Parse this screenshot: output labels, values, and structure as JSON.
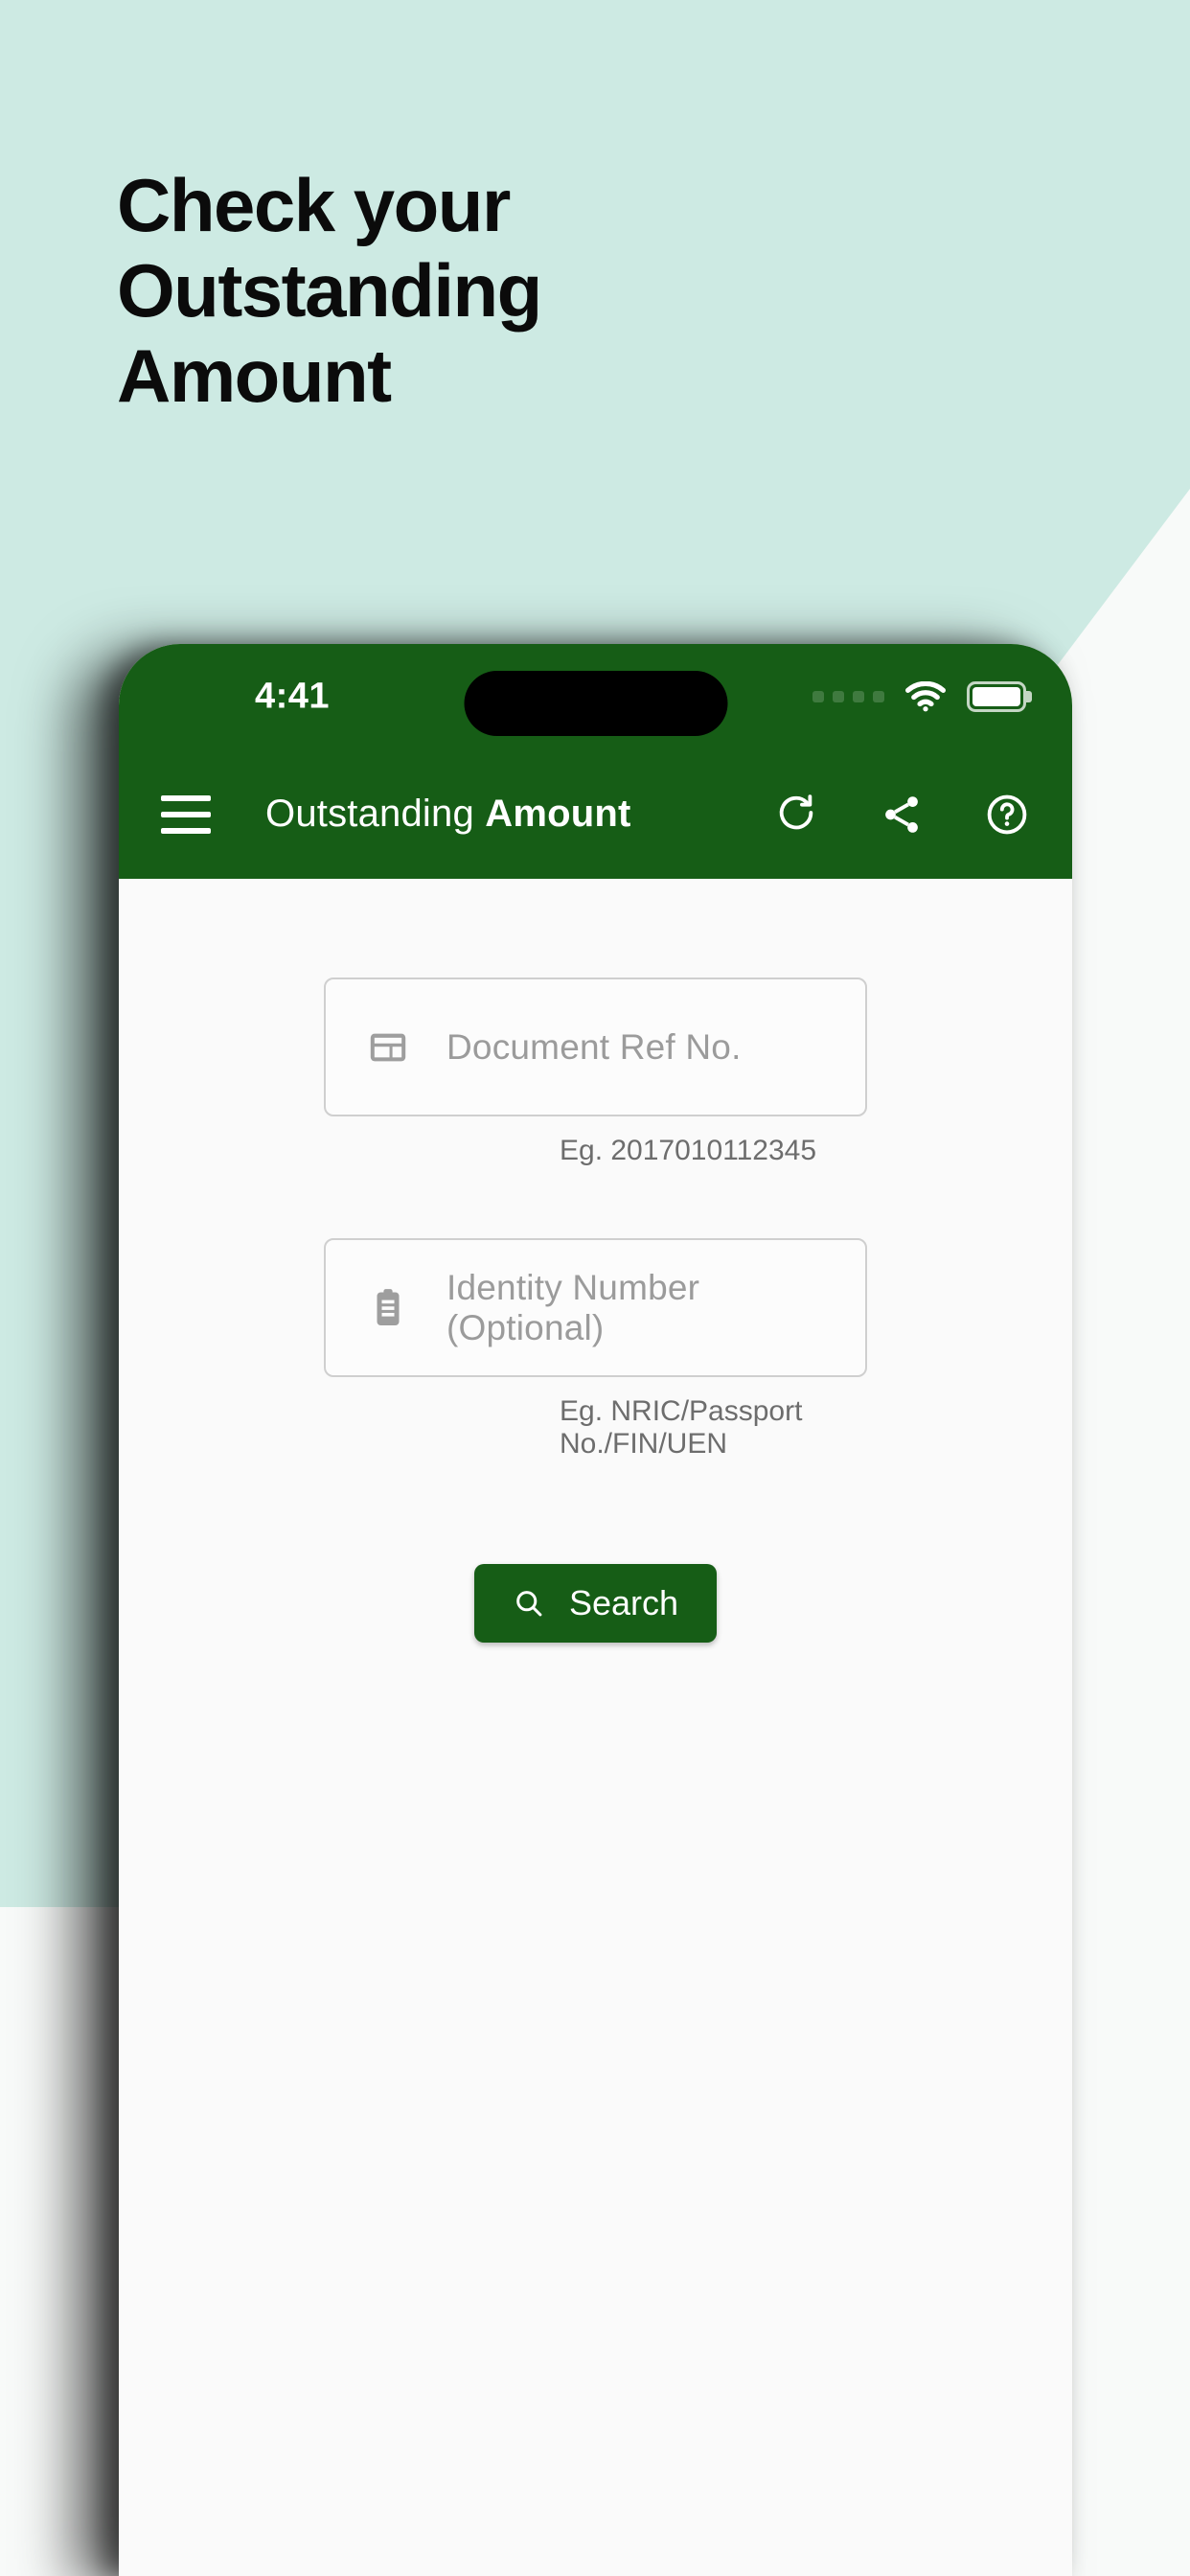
{
  "promo": {
    "headline_lines": [
      "Check your",
      "Outstanding",
      "Amount"
    ],
    "background_color": "#cdeae3"
  },
  "phone": {
    "status_bar": {
      "time": "4:41",
      "signal_icon": "signal-dots-icon",
      "wifi_icon": "wifi-icon",
      "battery_icon": "battery-full-icon",
      "background_color": "#165d16"
    },
    "app_bar": {
      "menu_icon": "hamburger-menu-icon",
      "title_light": "Outstanding",
      "title_bold": "Amount",
      "actions": [
        {
          "name": "refresh-icon",
          "label": "Refresh"
        },
        {
          "name": "share-icon",
          "label": "Share"
        },
        {
          "name": "help-icon",
          "label": "Help"
        }
      ],
      "background_color": "#165d16"
    },
    "form": {
      "fields": [
        {
          "icon": "document-ref-icon",
          "placeholder": "Document Ref No.",
          "value": "",
          "helper": "Eg. 2017010112345"
        },
        {
          "icon": "clipboard-identity-icon",
          "placeholder": "Identity Number (Optional)",
          "value": "",
          "helper": "Eg. NRIC/Passport No./FIN/UEN"
        }
      ],
      "search_button": {
        "label": "Search",
        "icon": "search-icon",
        "background_color": "#165d16"
      }
    }
  }
}
